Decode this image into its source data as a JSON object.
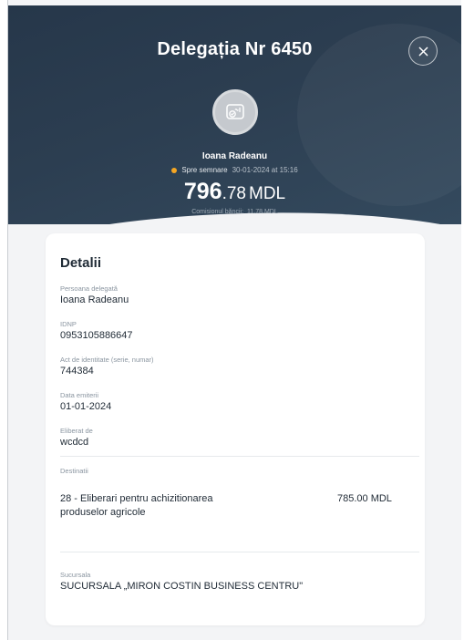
{
  "header": {
    "title": "Delegația Nr 6450",
    "close_icon": "close-icon",
    "avatar_icon": "id-card-icon"
  },
  "summary": {
    "name": "Ioana Radeanu",
    "status": "Spre semnare",
    "status_color": "#f5a623",
    "date": "30-01-2024 at 15:16",
    "amount_int": "796",
    "amount_dec": ".78",
    "currency": "MDL",
    "commission_label": "Comisionul băncii:",
    "commission_value": "11.78 MDL"
  },
  "details": {
    "title": "Detalii",
    "fields": [
      {
        "label": "Persoana delegată",
        "value": "Ioana Radeanu"
      },
      {
        "label": "IDNP",
        "value": "0953105886647"
      },
      {
        "label": "Act de identitate (serie, numar)",
        "value": "744384"
      },
      {
        "label": "Data emiterii",
        "value": "01-01-2024"
      },
      {
        "label": "Eliberat de",
        "value": "wcdcd"
      }
    ],
    "destinations_label": "Destinatii",
    "destination": {
      "text": "28 - Eliberari pentru achizitionarea produselor agricole",
      "amount": "785.00 MDL"
    },
    "branch_label": "Sucursala",
    "branch_value": "SUCURSALA „MIRON COSTIN BUSINESS CENTRU\""
  },
  "colors": {
    "header_bg": "#2c3e51",
    "accent_status": "#f5a623"
  }
}
